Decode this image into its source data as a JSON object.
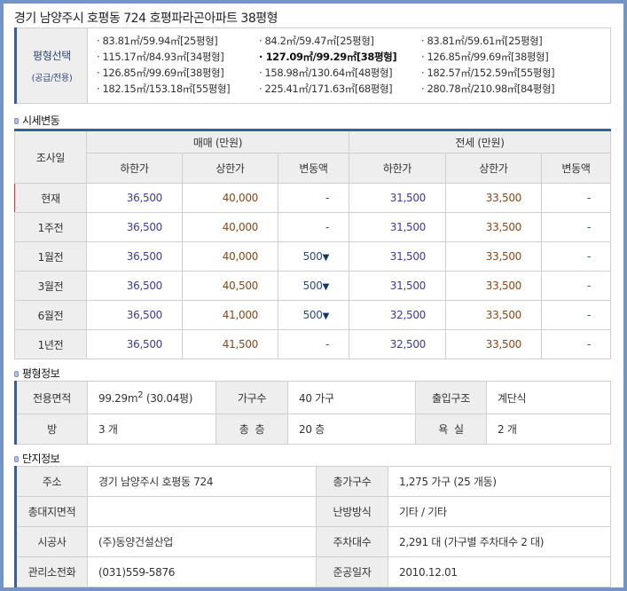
{
  "title": "경기 남양주시 호평동 724 호평파라곤아파트 38평형",
  "size_select": {
    "label": "평형선택",
    "sublabel": "(공급/전용)",
    "selected_index": 4,
    "options": [
      "· 83.81㎡/59.94㎡[25평형]",
      "· 84.2㎡/59.47㎡[25평형]",
      "· 83.81㎡/59.61㎡[25평형]",
      "· 115.17㎡/84.93㎡[34평형]",
      "· 127.09㎡/99.29㎡[38평형]",
      "· 126.85㎡/99.69㎡[38평형]",
      "· 126.85㎡/99.69㎡[38평형]",
      "· 158.98㎡/130.64㎡[48평형]",
      "· 182.57㎡/152.59㎡[55평형]",
      "· 182.15㎡/153.18㎡[55평형]",
      "· 225.41㎡/171.63㎡[68평형]",
      "· 280.78㎡/210.98㎡[84평형]"
    ]
  },
  "price": {
    "section": "시세변동",
    "date_header": "조사일",
    "sale_header": "매매 (만원)",
    "jeonse_header": "전세 (만원)",
    "sub_headers": [
      "하한가",
      "상한가",
      "변동액",
      "하한가",
      "상한가",
      "변동액"
    ],
    "rows": [
      {
        "date": "현재",
        "s_lo": "36,500",
        "s_hi": "40,000",
        "s_ch": "-",
        "s_dir": "",
        "j_lo": "31,500",
        "j_hi": "33,500",
        "j_ch": "-"
      },
      {
        "date": "1주전",
        "s_lo": "36,500",
        "s_hi": "40,000",
        "s_ch": "-",
        "s_dir": "",
        "j_lo": "31,500",
        "j_hi": "33,500",
        "j_ch": "-"
      },
      {
        "date": "1월전",
        "s_lo": "36,500",
        "s_hi": "40,000",
        "s_ch": "500",
        "s_dir": "▼",
        "j_lo": "31,500",
        "j_hi": "33,500",
        "j_ch": "-"
      },
      {
        "date": "3월전",
        "s_lo": "36,500",
        "s_hi": "40,500",
        "s_ch": "500",
        "s_dir": "▼",
        "j_lo": "31,500",
        "j_hi": "33,500",
        "j_ch": "-"
      },
      {
        "date": "6월전",
        "s_lo": "36,500",
        "s_hi": "41,000",
        "s_ch": "500",
        "s_dir": "▼",
        "j_lo": "32,500",
        "j_hi": "33,500",
        "j_ch": "-"
      },
      {
        "date": "1년전",
        "s_lo": "36,500",
        "s_hi": "41,500",
        "s_ch": "-",
        "s_dir": "",
        "j_lo": "32,500",
        "j_hi": "33,500",
        "j_ch": "-"
      }
    ]
  },
  "unit": {
    "section": "평형정보",
    "area_label": "전용면적",
    "area_value": "99.29m",
    "area_sup": "2",
    "area_pyeong": " (30.04평)",
    "households_label": "가구수",
    "households_value": "40 가구",
    "entrance_label": "출입구조",
    "entrance_value": "계단식",
    "rooms_label": "방",
    "rooms_value": "3 개",
    "floors_label": "총  층",
    "floors_value": "20 층",
    "bath_label": "욕  실",
    "bath_value": "2 개"
  },
  "complex": {
    "section": "단지정보",
    "address_label": "주소",
    "address_value": "경기 남양주시 호평동 724",
    "total_households_label": "총가구수",
    "total_households_value": "1,275 가구 (25 개동)",
    "land_area_label": "총대지면적",
    "land_area_value": "",
    "heating_label": "난방방식",
    "heating_value": "기타 / 기타",
    "builder_label": "시공사",
    "builder_value": "(주)동양건설산업",
    "parking_label": "주차대수",
    "parking_value": "2,291 대 (가구별 주차대수 2 대)",
    "phone_label": "관리소전화",
    "phone_value": "(031)559-5876",
    "completion_label": "준공일자",
    "completion_value": "2010.12.01"
  }
}
